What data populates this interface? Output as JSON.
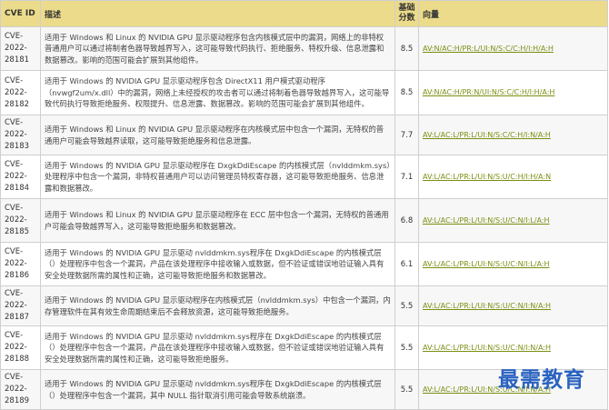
{
  "table": {
    "headers": {
      "cve_id": "CVE ID",
      "description": "描述",
      "score": "基础\n分数",
      "vector": "向量"
    },
    "rows": [
      {
        "cve_id": "CVE-2022-28181",
        "description": "适用于 Windows 和 Linux 的 NVIDIA GPU 显示驱动程序包含内核模式层中的漏洞，网络上的非特权普通用户可以通过将制者色器导致越界写入，这可能导致代码执行、拒绝服务、特权升级、信息泄露和数据篡改。影响的范围可能会扩展到其他组件。",
        "score": "8.5",
        "vector": "AV:N/AC:H/PR:L/UI:N/S:C/C:H/I:H/A:H"
      },
      {
        "cve_id": "CVE-2022-28182",
        "description": "适用于 Windows 的 NVIDIA GPU 显示驱动程序包含 DirectX11 用户模式驱动程序（nvwgf2um/x.dll）中的漏洞，网络上未经授权的攻击者可以通过将制着色器导致越界写入，这可能导致代码执行导致拒绝服务、权限提升、信息泄露、数据篡改。影响的范围可能会扩展到其他组件。",
        "score": "8.5",
        "vector": "AV:N/AC:H/PR:N/UI:N/S:C/C:H/I:H/A:H"
      },
      {
        "cve_id": "CVE-2022-28183",
        "description": "适用于 Windows 和 Linux 的 NVIDIA GPU 显示驱动程序在内核模式层中包含一个漏洞，无特权的普通用户可能会导致越界读取，这可能导致拒绝服务和信息泄露。",
        "score": "7.7",
        "vector": "AV:L/AC:L/PR:L/UI:N/S:C/C:H/I:N/A:H"
      },
      {
        "cve_id": "CVE-2022-28184",
        "description": "适用于 Windows 的 NVIDIA GPU 显示驱动程序在 DxgkDdiEscape 的内核模式层（nvlddmkm.sys）处理程序中包含一个漏洞，非特权普通用户可以访问管理员特权寄存器，这可能导致拒绝服务、信息泄露和数据篡改。",
        "score": "7.1",
        "vector": "AV:L/AC:L/PR:L/UI:N/S:U/C:H/I:H/A:N"
      },
      {
        "cve_id": "CVE-2022-28185",
        "description": "适用于 Windows 和 Linux 的 NVIDIA GPU 显示驱动程序在 ECC 层中包含一个漏洞，无特权的普通用户可能会导致越界写入，这可能导致拒绝服务和数据篡改。",
        "score": "6.8",
        "vector": "AV:L/AC:L/PR:L/UI:N/S:U/C:N/I:L/A:H"
      },
      {
        "cve_id": "CVE-2022-28186",
        "description": "适用于 Windows 的 NVIDIA GPU 显示驱动 nvlddmkm.sys程序在 DxgkDdiEscape 的内核模式层（）处理程序中包含一个漏洞，产品在该处理程序中接收输入或数据，但不验证或错误地验证输入具有安全处理数据所需的属性和正确，这可能导致拒绝服务和数据篡改。",
        "score": "6.1",
        "vector": "AV:L/AC:L/PR:L/UI:N/S:U/C:N/I:L/A:H"
      },
      {
        "cve_id": "CVE-2022-28187",
        "description": "适用于 Windows 的 NVIDIA GPU 显示驱动程序在内核模式层（nvlddmkm.sys）中包含一个漏洞，内存管理软件在其有效生命周期结束后不会释放资源，这可能导致拒绝服务。",
        "score": "5.5",
        "vector": "AV:L/AC:L/PR:L/UI:N/S:U/C:N/I:N/A:H"
      },
      {
        "cve_id": "CVE-2022-28188",
        "description": "适用于 Windows 的 NVIDIA GPU 显示驱动 nvlddmkm.sys程序在 DxgkDdiEscape 的内核模式层（）处理程序中包含一个漏洞，产品在该处理程序中接收输入或数据，但不验证或错误地验证输入具有安全处理数据所需的属性和正确，这可能导致拒绝服务。",
        "score": "5.5",
        "vector": "AV:L/AC:L/PR:L/UI:N/S:U/C:N/I:N/A:H"
      },
      {
        "cve_id": "CVE-2022-28189",
        "description": "适用于 Windows 的 NVIDIA GPU 显示驱动 nvlddmkm.sys程序在 DxgkDdiEscape 的内核模式层（）处理程序中包含一个漏洞，其中 NULL 指针取消引用可能会导致系统崩溃。",
        "score": "5.5",
        "vector": "AV:L/AC:L/PR:L/UI:N/S:U/C:N/I:N/A:H"
      }
    ]
  },
  "watermark": "最需教育",
  "colors": {
    "header_bg": "#ebdb8a",
    "link": "#7a8f12",
    "watermark": "#2a63c0"
  }
}
